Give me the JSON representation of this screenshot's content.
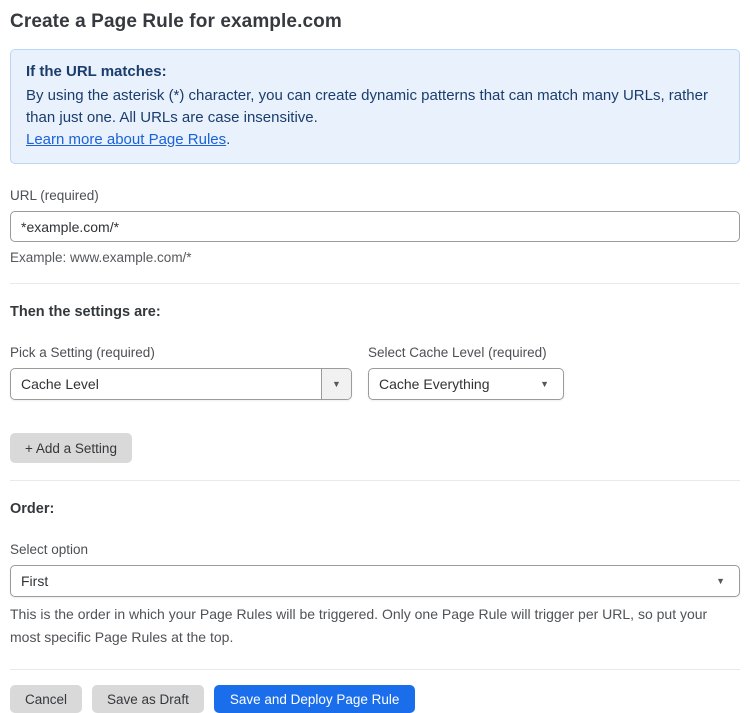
{
  "page": {
    "title": "Create a Page Rule for example.com"
  },
  "info_box": {
    "heading": "If the URL matches:",
    "body": "By using the asterisk (*) character, you can create dynamic patterns that can match many URLs, rather than just one. All URLs are case insensitive.",
    "link_label": "Learn more about Page Rules",
    "link_suffix": "."
  },
  "url_field": {
    "label": "URL (required)",
    "value": "*example.com/*",
    "example": "Example: www.example.com/*"
  },
  "settings": {
    "heading": "Then the settings are:",
    "setting_select": {
      "label": "Pick a Setting (required)",
      "value": "Cache Level"
    },
    "cache_level_select": {
      "label": "Select Cache Level (required)",
      "value": "Cache Everything"
    },
    "add_button_label": "+ Add a Setting"
  },
  "order": {
    "heading": "Order:",
    "label": "Select option",
    "value": "First",
    "help": "This is the order in which your Page Rules will be triggered. Only one Page Rule will trigger per URL, so put your most specific Page Rules at the top."
  },
  "actions": {
    "cancel_label": "Cancel",
    "save_draft_label": "Save as Draft",
    "save_deploy_label": "Save and Deploy Page Rule"
  },
  "icons": {
    "dropdown_arrow": "▼"
  },
  "colors": {
    "accent_blue": "#1a6eeb",
    "info_bg": "#e8f1fc",
    "info_border": "#bcd6f5",
    "info_text": "#1b3d6d",
    "link_blue": "#1a62d8",
    "button_gray": "#d9d9d9"
  }
}
